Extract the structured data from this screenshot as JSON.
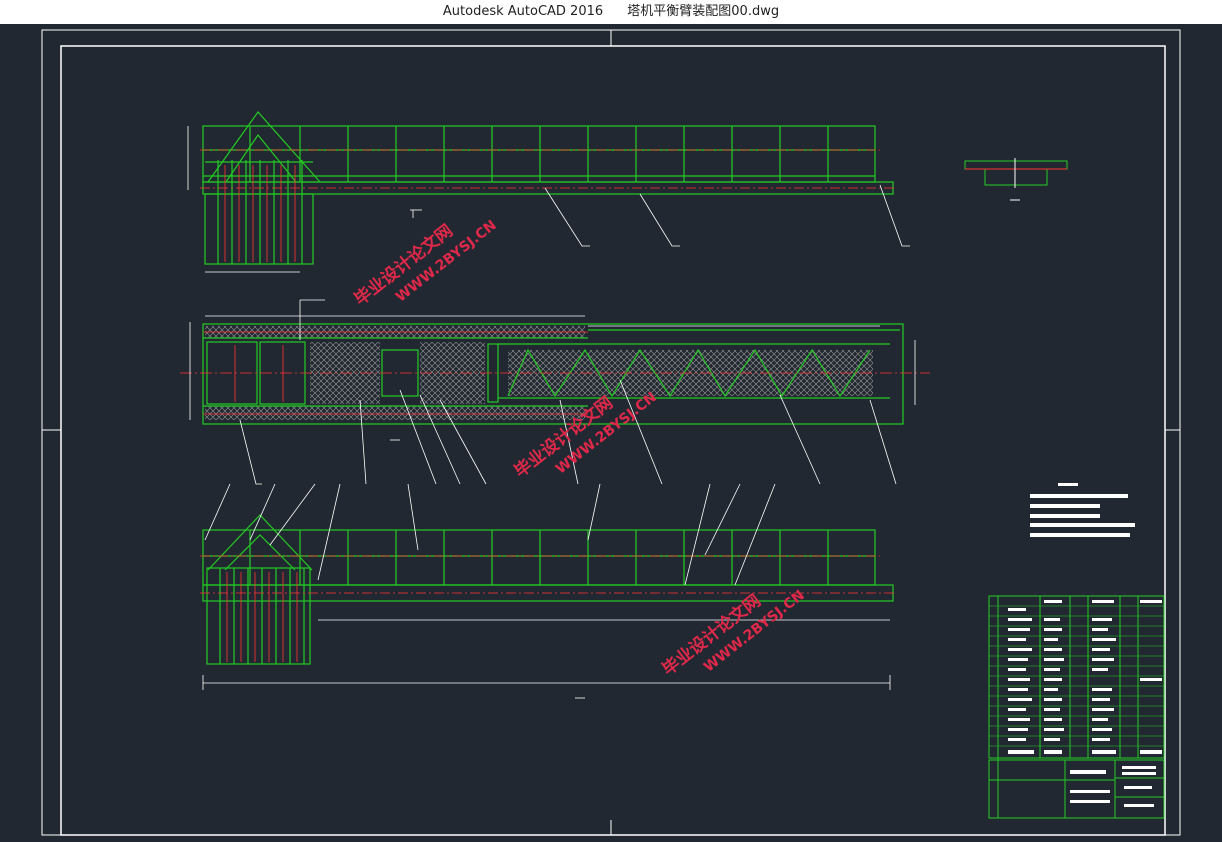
{
  "window": {
    "app_title": "Autodesk AutoCAD 2016",
    "file_name": "塔机平衡臂装配图00.dwg"
  },
  "drawing": {
    "watermark_cn": "毕业设计论文网",
    "watermark_url": "WWW.2BYSJ.CN",
    "colors": {
      "background": "#222831",
      "frame": "#ffffff",
      "structure": "#22cc22",
      "centerline": "#ff2222",
      "mesh": "#bfbfbf",
      "watermark": "#e0284a"
    }
  }
}
